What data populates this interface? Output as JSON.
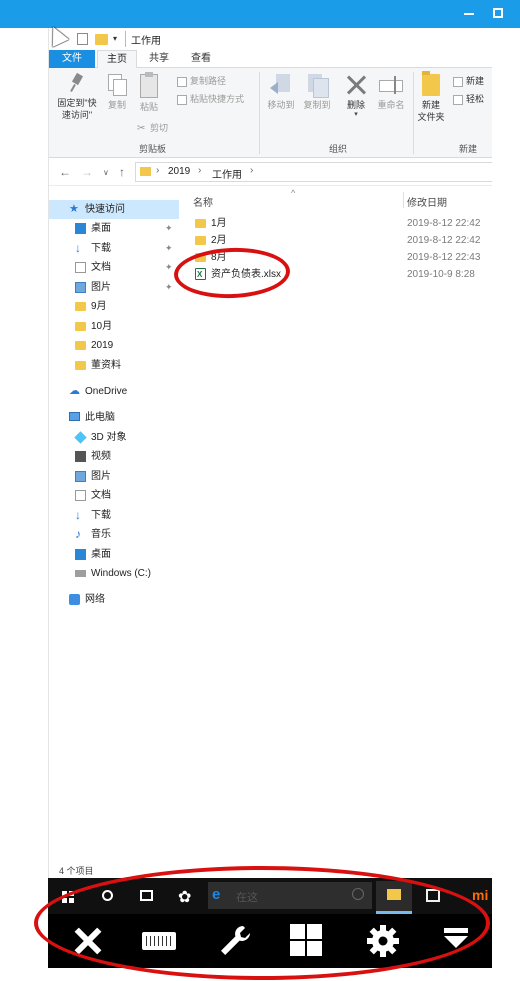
{
  "window": {
    "title": "工作用",
    "qat_arrow": "▾"
  },
  "tabs": {
    "file": "文件",
    "home": "主页",
    "share": "共享",
    "view": "查看"
  },
  "ribbon": {
    "pin_quick_access": "固定到\"快\n速访问\"",
    "copy": "复制",
    "paste": "粘贴",
    "copy_path": "复制路径",
    "paste_shortcut": "粘贴快捷方式",
    "cut": "剪切",
    "clipboard_group": "剪贴板",
    "move_to": "移动到",
    "copy_to": "复制到",
    "delete": "删除",
    "rename": "重命名",
    "organize_group": "组织",
    "new_folder": "新建\n文件夹",
    "new_item": "新建",
    "easy_access": "轻松",
    "new_group": "新建"
  },
  "address": {
    "back": "←",
    "forward": "→",
    "recent": "∨",
    "up": "↑",
    "sep": "›",
    "crumbs": [
      "2019",
      "工作用"
    ]
  },
  "nav_pane": {
    "items": [
      {
        "label": "快速访问",
        "icon": "star-icon",
        "glyph": "★"
      },
      {
        "label": "桌面",
        "icon": "desktop-icon"
      },
      {
        "label": "下载",
        "icon": "download-icon",
        "glyph": "↓"
      },
      {
        "label": "文档",
        "icon": "document-icon"
      },
      {
        "label": "图片",
        "icon": "picture-icon"
      },
      {
        "label": "9月",
        "icon": "folder-icon"
      },
      {
        "label": "10月",
        "icon": "folder-icon"
      },
      {
        "label": "2019",
        "icon": "folder-icon"
      },
      {
        "label": "董资料",
        "icon": "folder-icon"
      },
      {
        "label": "OneDrive",
        "icon": "cloud-icon",
        "glyph": "☁"
      },
      {
        "label": "此电脑",
        "icon": "computer-icon"
      },
      {
        "label": "3D 对象",
        "icon": "3d-objects-icon"
      },
      {
        "label": "视频",
        "icon": "video-icon"
      },
      {
        "label": "图片",
        "icon": "picture-icon"
      },
      {
        "label": "文档",
        "icon": "document-icon"
      },
      {
        "label": "下载",
        "icon": "download-icon",
        "glyph": "↓"
      },
      {
        "label": "音乐",
        "icon": "music-icon",
        "glyph": "♪"
      },
      {
        "label": "桌面",
        "icon": "desktop-icon"
      },
      {
        "label": "Windows (C:)",
        "icon": "drive-icon"
      },
      {
        "label": "网络",
        "icon": "network-icon"
      }
    ],
    "pin_glyph": "📌"
  },
  "content": {
    "sort_indicator": "^",
    "col_name": "名称",
    "col_date": "修改日期",
    "files": [
      {
        "name": "1月",
        "date": "2019-8-12 22:42",
        "type": "folder"
      },
      {
        "name": "2月",
        "date": "2019-8-12 22:42",
        "type": "folder"
      },
      {
        "name": "8月",
        "date": "2019-8-12 22:43",
        "type": "folder"
      },
      {
        "name": "资产负债表.xlsx",
        "date": "2019-10-9 8:28",
        "type": "xlsx"
      }
    ]
  },
  "status": {
    "item_count": "4 个项目"
  },
  "taskbar": {
    "fan_glyph": "✿",
    "ie_glyph": "e",
    "search_placeholder": "在这",
    "mi_label": "mi"
  },
  "colors": {
    "accent": "#1a9ce8",
    "annotation": "#d91010",
    "folder": "#f3c74a",
    "excel": "#1e7145"
  }
}
